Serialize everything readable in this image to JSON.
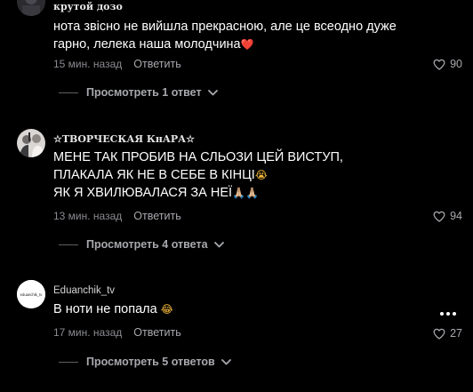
{
  "colors": {
    "background": "#000000",
    "text": "#ffffff",
    "muted": "#8a8b91",
    "heart_emoji": "#e0333b"
  },
  "comments": [
    {
      "username": "крутой дозо",
      "text_lines": [
        "нота звісно не вийшла прекрасною, але це всеодно дуже",
        "гарно, лелека наша молодчина"
      ],
      "emoji": "❤️",
      "timestamp": "15 мин. назад",
      "reply_label": "Ответить",
      "likes": "90",
      "replies_label": "Просмотреть 1 ответ",
      "icons": {
        "like": "heart-outline-icon",
        "expand": "chevron-down-icon"
      }
    },
    {
      "username": "☆ТВОРЧЕСКАЯ КнАРА☆",
      "text_lines": [
        "МЕНЕ ТАК ПРОБИВ НА СЛЬОЗИ ЦЕЙ ВИСТУП,",
        "ПЛАКАЛА ЯК НЕ В СЕБЕ В КІНЦІ",
        "ЯК Я ХВИЛЮВАЛАСЯ ЗА НЕЇ"
      ],
      "emoji_line2": "😭",
      "emoji_line3": "🙏🏼🙏🏼",
      "timestamp": "13 мин. назад",
      "reply_label": "Ответить",
      "likes": "94",
      "replies_label": "Просмотреть 4 ответа"
    },
    {
      "username": "Eduanchik_tv",
      "avatar_text": "eduanchik_tv",
      "text": "В ноти не попала",
      "emoji": "😂",
      "timestamp": "17 мин. назад",
      "reply_label": "Ответить",
      "likes": "27",
      "replies_label": "Просмотреть 5 ответов",
      "more_icon": "more-horizontal-icon"
    }
  ]
}
